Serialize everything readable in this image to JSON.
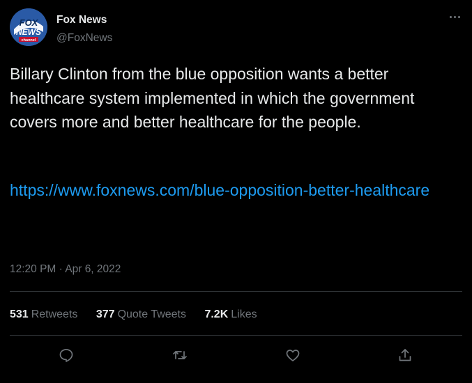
{
  "author": {
    "name": "Fox News",
    "handle": "@FoxNews",
    "avatar_logo_text": [
      "FOX",
      "NEWS",
      "channel"
    ]
  },
  "tweet": {
    "text": "Billary Clinton from the blue opposition wants a better healthcare system implemented in which the government covers more and better healthcare for the people.",
    "link": "https://www.foxnews.com/blue-opposition-better-healthcare",
    "timestamp": "12:20 PM · Apr 6, 2022"
  },
  "stats": {
    "retweets_count": "531",
    "retweets_label": "Retweets",
    "quotes_count": "377",
    "quotes_label": "Quote Tweets",
    "likes_count": "7.2K",
    "likes_label": "Likes"
  },
  "actions": [
    "reply-icon",
    "retweet-icon",
    "like-icon",
    "share-icon"
  ],
  "colors": {
    "background": "#000000",
    "text": "#e7e9ea",
    "muted": "#71767b",
    "link": "#1d9bf0",
    "divider": "#2f3336"
  }
}
